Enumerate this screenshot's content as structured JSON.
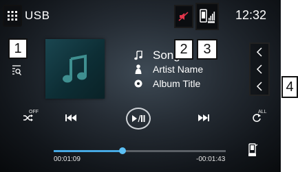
{
  "header": {
    "source": "USB",
    "clock": "12:32"
  },
  "track": {
    "song": "Song",
    "artist": "Artist Name",
    "album": "Album Title"
  },
  "controls": {
    "shuffle_state": "OFF",
    "repeat_state": "ALL"
  },
  "progress": {
    "elapsed": "00:01:09",
    "remaining": "-00:01:43",
    "fraction": 0.4
  },
  "callouts": [
    "1",
    "2",
    "3",
    "4"
  ],
  "colors": {
    "accent": "#47a9e3",
    "mute_icon": "#e0354b",
    "album_note": "#3f8f90"
  },
  "icons": {
    "menu": "grid-menu-icon",
    "mute": "speaker-mute-icon",
    "phone": "phone-signal-icon",
    "list": "list-search-icon",
    "song": "music-note-icon",
    "artist": "person-icon",
    "album": "disc-icon",
    "shuffle": "shuffle-icon",
    "prev": "previous-track-icon",
    "play_pause": "play-pause-icon",
    "next": "next-track-icon",
    "repeat": "repeat-icon",
    "device": "device-icon",
    "chevron": "chevron-left-icon"
  }
}
